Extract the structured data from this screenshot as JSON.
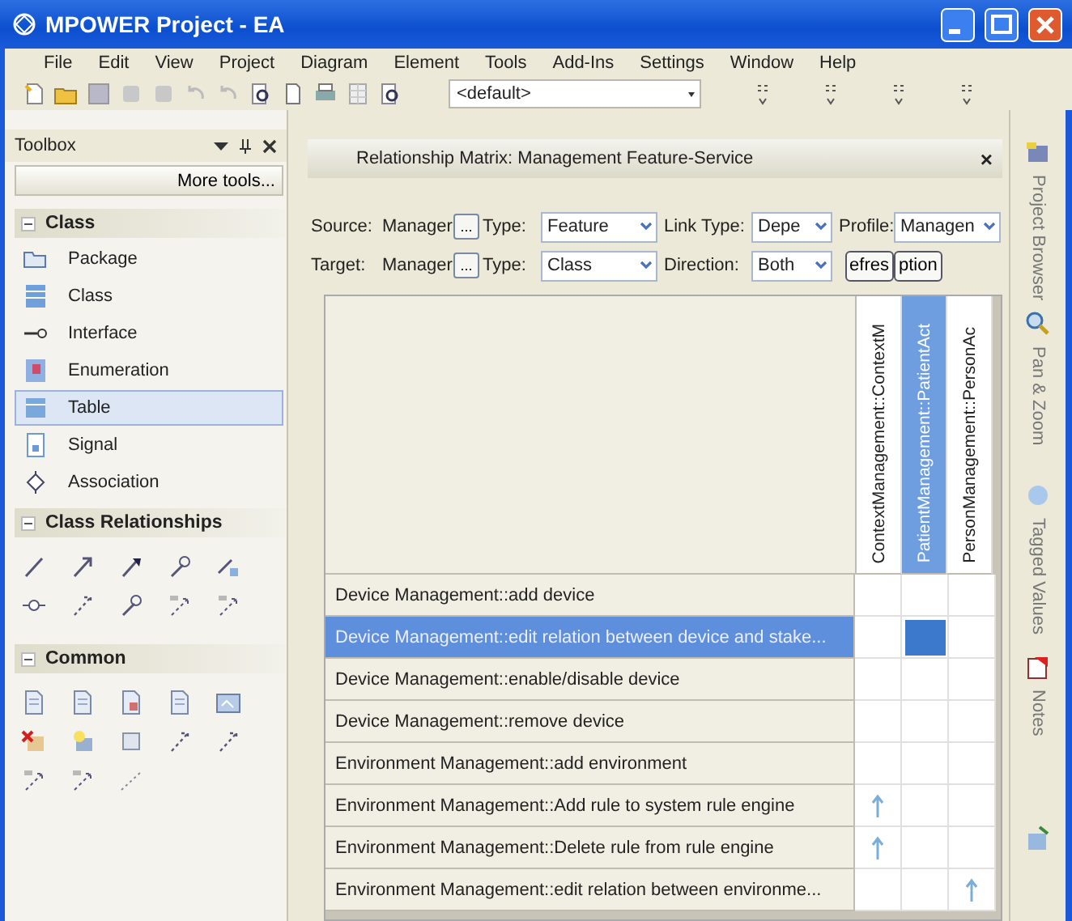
{
  "window": {
    "title": "MPOWER Project - EA"
  },
  "menu": [
    "File",
    "Edit",
    "View",
    "Project",
    "Diagram",
    "Element",
    "Tools",
    "Add-Ins",
    "Settings",
    "Window",
    "Help"
  ],
  "toolbar": {
    "profile": "<default>"
  },
  "toolbox": {
    "title": "Toolbox",
    "more_tools": "More tools...",
    "sections": [
      {
        "title": "Class",
        "expanded": true,
        "kind": "list",
        "items": [
          {
            "label": "Package",
            "kind": "package",
            "selected": false
          },
          {
            "label": "Class",
            "kind": "class",
            "selected": false
          },
          {
            "label": "Interface",
            "kind": "interface",
            "selected": false
          },
          {
            "label": "Enumeration",
            "kind": "enumeration",
            "selected": false
          },
          {
            "label": "Table",
            "kind": "table",
            "selected": true
          },
          {
            "label": "Signal",
            "kind": "signal",
            "selected": false
          },
          {
            "label": "Association",
            "kind": "association",
            "selected": false
          }
        ]
      },
      {
        "title": "Class Relationships",
        "expanded": true,
        "kind": "relationships"
      },
      {
        "title": "Common",
        "expanded": true,
        "kind": "common"
      }
    ]
  },
  "matrix": {
    "title": "Relationship Matrix: Management Feature-Service",
    "close": "×",
    "filters": [
      [
        {
          "kind": "label",
          "text": "Source:"
        },
        {
          "kind": "field",
          "text": "Manager"
        },
        {
          "kind": "browse",
          "text": "..."
        },
        {
          "kind": "label",
          "text": "Type:"
        },
        {
          "kind": "select",
          "text": "Feature"
        },
        {
          "kind": "label",
          "text": "Link Type:"
        },
        {
          "kind": "select",
          "text": "Depe"
        },
        {
          "kind": "label",
          "text": "Profile:"
        },
        {
          "kind": "select",
          "text": "Managen"
        }
      ],
      [
        {
          "kind": "label",
          "text": "Target:"
        },
        {
          "kind": "field",
          "text": "Manager"
        },
        {
          "kind": "browse",
          "text": "..."
        },
        {
          "kind": "label",
          "text": "Type:"
        },
        {
          "kind": "select",
          "text": "Class"
        },
        {
          "kind": "label",
          "text": "Direction:"
        },
        {
          "kind": "select",
          "text": "Both"
        },
        {
          "kind": "button",
          "text": "efres"
        },
        {
          "kind": "button",
          "text": "ption"
        }
      ]
    ],
    "columns": [
      {
        "label": "ContextManagement::ContextM",
        "selected": false
      },
      {
        "label": "PatientManagement::PatientAct",
        "selected": true
      },
      {
        "label": "PersonManagement::PersonAc",
        "selected": false
      }
    ],
    "rows": [
      {
        "label": "Device Management::add device",
        "selected": false,
        "cells": [
          {
            "link": false,
            "selected": false
          },
          {
            "link": false,
            "selected": false
          },
          {
            "link": false,
            "selected": false
          }
        ]
      },
      {
        "label": "Device Management::edit relation between device and stake...",
        "selected": true,
        "cells": [
          {
            "link": false,
            "selected": false
          },
          {
            "link": false,
            "selected": true
          },
          {
            "link": false,
            "selected": false
          }
        ]
      },
      {
        "label": "Device Management::enable/disable device",
        "selected": false,
        "cells": [
          {
            "link": false,
            "selected": false
          },
          {
            "link": false,
            "selected": false
          },
          {
            "link": false,
            "selected": false
          }
        ]
      },
      {
        "label": "Device Management::remove device",
        "selected": false,
        "cells": [
          {
            "link": false,
            "selected": false
          },
          {
            "link": false,
            "selected": false
          },
          {
            "link": false,
            "selected": false
          }
        ]
      },
      {
        "label": "Environment Management::add environment",
        "selected": false,
        "cells": [
          {
            "link": false,
            "selected": false
          },
          {
            "link": false,
            "selected": false
          },
          {
            "link": false,
            "selected": false
          }
        ]
      },
      {
        "label": "Environment Management::Add rule to system rule engine",
        "selected": false,
        "cells": [
          {
            "link": true,
            "selected": false
          },
          {
            "link": false,
            "selected": false
          },
          {
            "link": false,
            "selected": false
          }
        ]
      },
      {
        "label": "Environment Management::Delete rule from rule engine",
        "selected": false,
        "cells": [
          {
            "link": true,
            "selected": false
          },
          {
            "link": false,
            "selected": false
          },
          {
            "link": false,
            "selected": false
          }
        ]
      },
      {
        "label": "Environment Management::edit relation between environme...",
        "selected": false,
        "cells": [
          {
            "link": false,
            "selected": false
          },
          {
            "link": false,
            "selected": false
          },
          {
            "link": true,
            "selected": false
          }
        ]
      }
    ]
  },
  "dock": [
    {
      "label": "Project Browser",
      "kind": "browser"
    },
    {
      "label": "Pan & Zoom",
      "kind": "zoom"
    },
    {
      "label": "Tagged Values",
      "kind": "tags"
    },
    {
      "label": "Notes",
      "kind": "notes"
    },
    {
      "kind": "properties"
    }
  ]
}
